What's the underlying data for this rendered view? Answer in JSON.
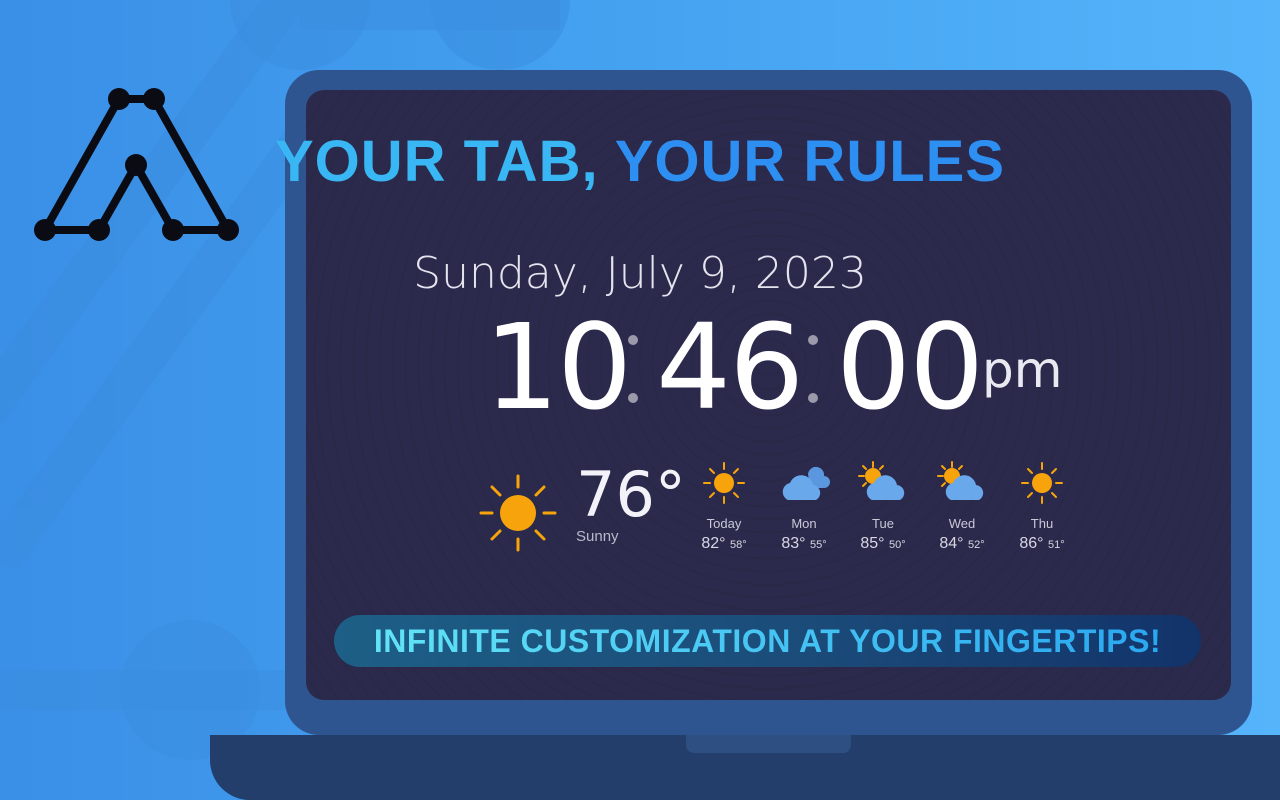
{
  "promo": {
    "headline_part1": "YOUR TAB,",
    "headline_part2": "YOUR RULES",
    "banner": "INFINITE CUSTOMIZATION AT YOUR FINGERTIPS!"
  },
  "clock": {
    "date": "Sunday, July 9, 2023",
    "hours": "10",
    "minutes": "46",
    "seconds": "00",
    "ampm": "pm"
  },
  "weather": {
    "current_temp": "76°",
    "current_condition": "Sunny",
    "current_icon": "sun-icon",
    "forecast": [
      {
        "day": "Today",
        "high": "82°",
        "low": "58°",
        "icon": "sun-icon"
      },
      {
        "day": "Mon",
        "high": "83°",
        "low": "55°",
        "icon": "cloud-icon"
      },
      {
        "day": "Tue",
        "high": "85°",
        "low": "50°",
        "icon": "partly-cloudy-icon"
      },
      {
        "day": "Wed",
        "high": "84°",
        "low": "52°",
        "icon": "partly-cloudy-icon"
      },
      {
        "day": "Thu",
        "high": "86°",
        "low": "51°",
        "icon": "sun-icon"
      }
    ]
  },
  "colors": {
    "background": "#46a4f2",
    "laptop_frame": "#2f5590",
    "screen": "#2a2948",
    "accent_sun": "#f7a40c",
    "accent_cloud": "#6aa8ec"
  }
}
